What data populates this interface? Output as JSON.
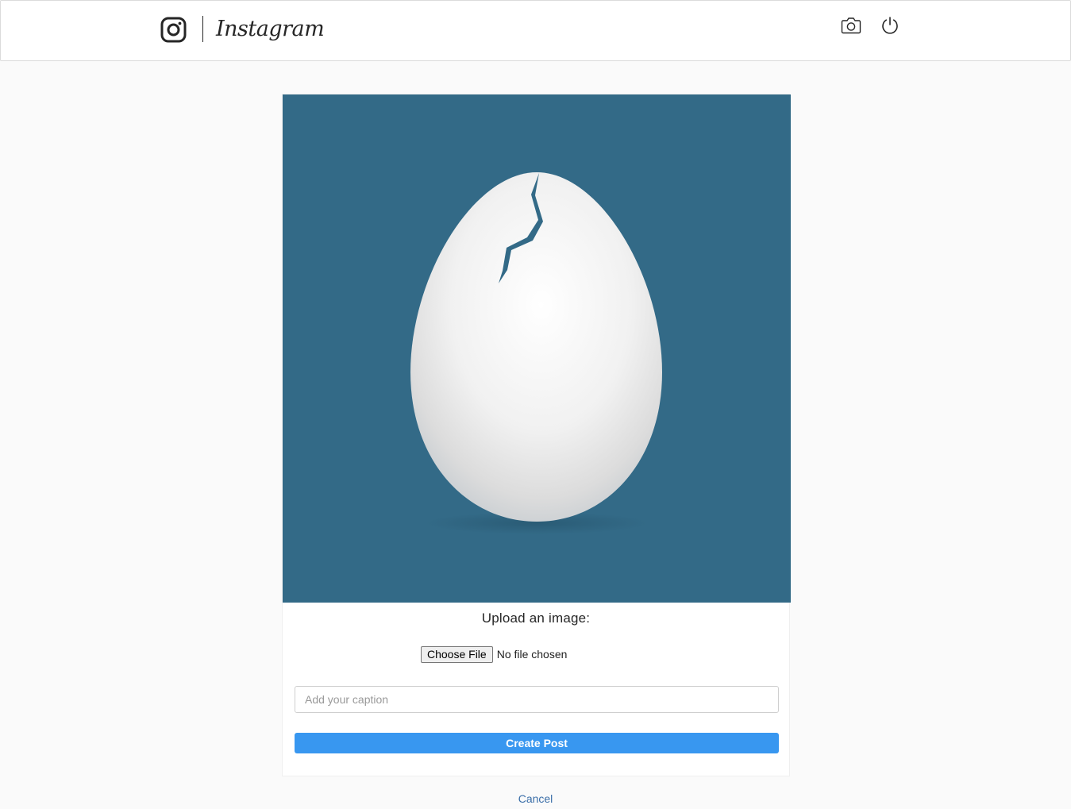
{
  "header": {
    "brand_name": "Instagram",
    "icons": {
      "logo": "instagram-glyph-icon",
      "camera": "camera-icon",
      "logout": "power-icon"
    }
  },
  "preview": {
    "image": "default-egg-avatar",
    "background_color": "#336a87"
  },
  "form": {
    "upload_label": "Upload an image:",
    "choose_file_label": "Choose File",
    "file_status": "No file chosen",
    "caption_placeholder": "Add your caption",
    "caption_value": "",
    "submit_label": "Create Post",
    "accent_color": "#3897f0"
  },
  "footer": {
    "cancel_label": "Cancel"
  }
}
